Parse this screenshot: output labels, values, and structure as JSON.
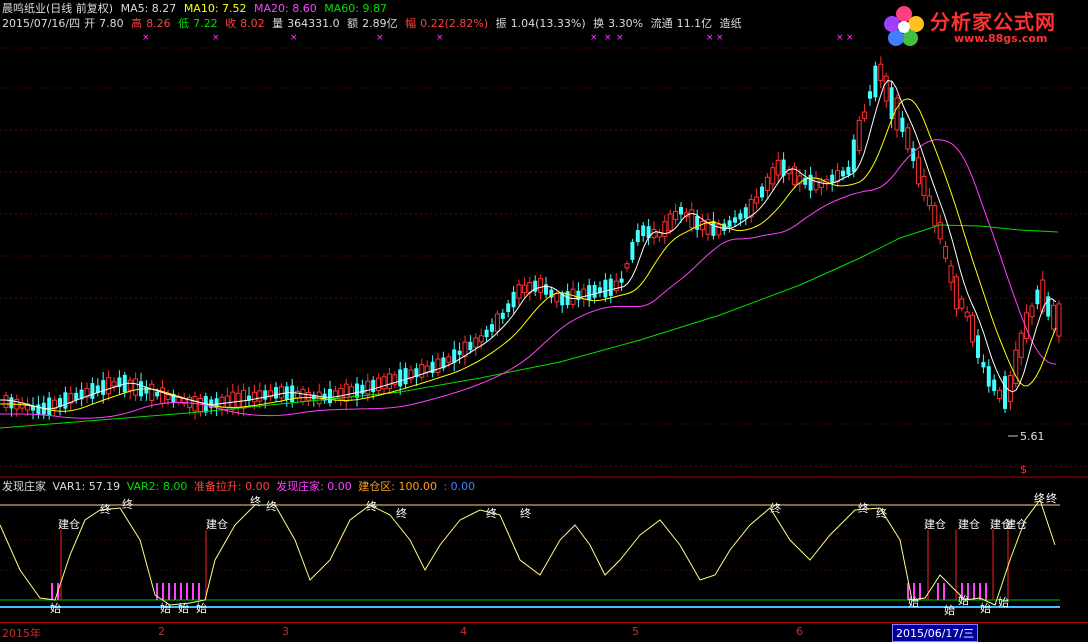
{
  "header": {
    "stock_name": "晨鸣纸业(日线 前复权)",
    "ma5": "MA5: 8.27",
    "ma10": "MA10: 7.52",
    "ma20": "MA20: 8.60",
    "ma60": "MA60: 9.87"
  },
  "quote": {
    "date": "2015/07/16/四",
    "open_label": "开",
    "open": "7.80",
    "high_label": "高",
    "high": "8.26",
    "low_label": "低",
    "low": "7.22",
    "close_label": "收",
    "close": "8.02",
    "volume_label": "量",
    "volume": "364331.0",
    "amount_label": "额",
    "amount": "2.89亿",
    "change_label": "幅",
    "change": "0.22(2.82%)",
    "amplitude_label": "振",
    "amplitude": "1.04(13.33%)",
    "turnover_label": "换",
    "turnover": "3.30%",
    "float_label": "流通",
    "float": "11.1亿",
    "sector": "造纸"
  },
  "logo": {
    "text": "分析家公式网",
    "url": "www.88gs.com"
  },
  "indicator": {
    "name": "发现庄家",
    "var1": "VAR1: 57.19",
    "var2": "VAR2: 8.00",
    "zbls": "准备拉升: 0.00",
    "fxzj": "发现庄家: 0.00",
    "jcq": "建仓区: 100.00",
    "extra": ": 0.00"
  },
  "markers": {
    "build": "建仓",
    "start": "始",
    "end": "终",
    "low_price": "5.61",
    "dollar": "$"
  },
  "axis": {
    "year": "2015年",
    "months": [
      "2",
      "3",
      "4",
      "5",
      "6"
    ],
    "cursor_date": "2015/06/17/三"
  },
  "colors": {
    "up": "#ff3030",
    "down": "#40ffff",
    "ma5": "#ffffff",
    "ma10": "#ffff00",
    "ma20": "#ff40ff",
    "ma60": "#00e000"
  }
}
